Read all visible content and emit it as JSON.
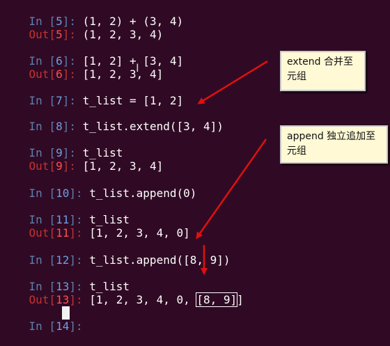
{
  "terminal": {
    "lines": [
      {
        "prompt_prefix": "In [",
        "num": "5",
        "prompt_suffix": "]: ",
        "code": "(1, 2) + (3, 4)"
      },
      {
        "prompt_prefix": "Out[",
        "num": "5",
        "prompt_suffix": "]: ",
        "code": "(1, 2, 3, 4)"
      },
      {
        "prompt_prefix": "In [",
        "num": "6",
        "prompt_suffix": "]: ",
        "code": "[1, 2] + [3, 4]"
      },
      {
        "prompt_prefix": "Out[",
        "num": "6",
        "prompt_suffix": "]: ",
        "code": "[1, 2, 3, 4]"
      },
      {
        "prompt_prefix": "In [",
        "num": "7",
        "prompt_suffix": "]: ",
        "code": "t_list = [1, 2]"
      },
      {
        "prompt_prefix": "In [",
        "num": "8",
        "prompt_suffix": "]: ",
        "code": "t_list.extend([3, 4])"
      },
      {
        "prompt_prefix": "In [",
        "num": "9",
        "prompt_suffix": "]: ",
        "code": "t_list"
      },
      {
        "prompt_prefix": "Out[",
        "num": "9",
        "prompt_suffix": "]: ",
        "code": "[1, 2, 3, 4]"
      },
      {
        "prompt_prefix": "In [",
        "num": "10",
        "prompt_suffix": "]: ",
        "code": "t_list.append(0)"
      },
      {
        "prompt_prefix": "In [",
        "num": "11",
        "prompt_suffix": "]: ",
        "code": "t_list"
      },
      {
        "prompt_prefix": "Out[",
        "num": "11",
        "prompt_suffix": "]: ",
        "code": "[1, 2, 3, 4, 0]"
      },
      {
        "prompt_prefix": "In [",
        "num": "12",
        "prompt_suffix": "]: ",
        "code": "t_list.append([8, 9])"
      },
      {
        "prompt_prefix": "In [",
        "num": "13",
        "prompt_suffix": "]: ",
        "code": "t_list"
      },
      {
        "prompt_prefix": "Out[",
        "num": "13",
        "prompt_suffix": "]: ",
        "code_before": "[1, 2, 3, 4, 0, ",
        "code_boxed": "[8, 9]",
        "code_after": "]"
      },
      {
        "prompt_prefix": "In [",
        "num": "14",
        "prompt_suffix": "]: ",
        "code": ""
      }
    ]
  },
  "annotations": {
    "extend_note": "extend 合并至元组",
    "append_note": "append 独立追加至元组"
  },
  "colors": {
    "background": "#300a24",
    "in_prompt": "#6f9fe0",
    "out_prompt": "#ff4f4f",
    "arrow": "#e01010",
    "note_background": "#fff9d6"
  },
  "icons": {
    "cursor": "block-cursor-icon",
    "text_cursor": "ibeam-cursor-icon"
  }
}
